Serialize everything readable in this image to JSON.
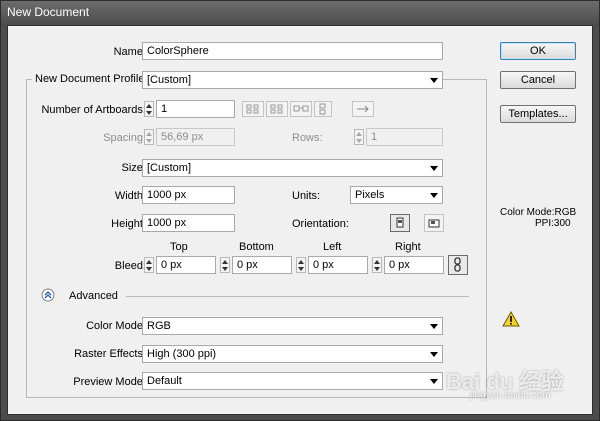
{
  "window": {
    "title": "New Document"
  },
  "name": {
    "label": "Name:",
    "value": "ColorSphere"
  },
  "profile": {
    "label": "New Document Profile:",
    "value": "[Custom]"
  },
  "artboards": {
    "label": "Number of Artboards:",
    "value": "1"
  },
  "spacing": {
    "label": "Spacing:",
    "value": "56,69 px"
  },
  "rows": {
    "label": "Rows:",
    "value": "1"
  },
  "size": {
    "label": "Size:",
    "value": "[Custom]"
  },
  "width": {
    "label": "Width:",
    "value": "1000 px"
  },
  "units": {
    "label": "Units:",
    "value": "Pixels"
  },
  "height": {
    "label": "Height:",
    "value": "1000 px"
  },
  "orientation": {
    "label": "Orientation:"
  },
  "bleed": {
    "label": "Bleed:",
    "top_label": "Top",
    "bottom_label": "Bottom",
    "left_label": "Left",
    "right_label": "Right",
    "top": "0 px",
    "bottom": "0 px",
    "left": "0 px",
    "right": "0 px"
  },
  "advanced": {
    "label": "Advanced"
  },
  "color_mode": {
    "label": "Color Mode:",
    "value": "RGB"
  },
  "raster_effects": {
    "label": "Raster Effects:",
    "value": "High (300 ppi)"
  },
  "preview_mode": {
    "label": "Preview Mode:",
    "value": "Default"
  },
  "buttons": {
    "ok": "OK",
    "cancel": "Cancel",
    "templates": "Templates..."
  },
  "info": {
    "color_mode": "Color Mode:RGB",
    "ppi": "PPI:300"
  },
  "watermark": {
    "text": "Bai du 经验",
    "url": "jingyan.baidu.com"
  },
  "icons": {
    "spinner": "spinner-arrows-icon",
    "arrange": [
      "grid-by-row-icon",
      "grid-by-column-icon",
      "arrange-by-row-icon",
      "arrange-by-column-icon",
      "change-to-rtl-icon"
    ],
    "orientation": [
      "portrait-icon",
      "landscape-icon"
    ],
    "link": "chain-link-icon",
    "advanced": "chevron-up-circle-icon",
    "warning": "warning-triangle-icon"
  },
  "colors": {
    "title_bar": "#4f4f4f",
    "dialog_bg": "#f0f0f0",
    "default_button_border": "#3c7fb1",
    "warning": "#f3d22d"
  }
}
